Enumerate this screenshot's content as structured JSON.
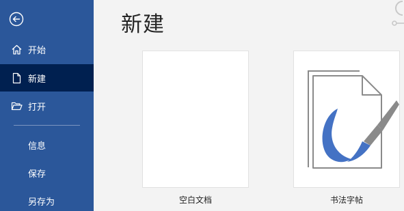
{
  "sidebar": {
    "back_icon": "back-arrow-icon",
    "items": [
      {
        "label": "开始",
        "icon": "home-icon"
      },
      {
        "label": "新建",
        "icon": "new-document-icon",
        "active": true
      },
      {
        "label": "打开",
        "icon": "open-folder-icon"
      },
      {
        "label": "信息"
      },
      {
        "label": "保存"
      },
      {
        "label": "另存为"
      }
    ]
  },
  "main": {
    "title": "新建",
    "templates": [
      {
        "label": "空白文档"
      },
      {
        "label": "书法字帖"
      }
    ]
  },
  "colors": {
    "sidebar_bg": "#2b579a",
    "sidebar_active_bg": "#002050",
    "main_bg": "#f3f3f3",
    "calligraphy_blue": "#4472c4"
  }
}
